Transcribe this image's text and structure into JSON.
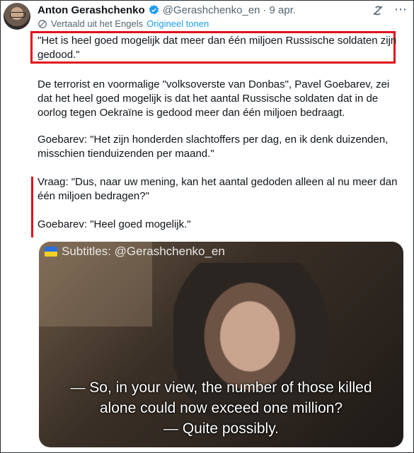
{
  "tweet": {
    "author_name": "Anton Gerashchenko",
    "handle": "@Gerashchenko_en",
    "dot": "·",
    "date": "9 apr.",
    "translated_label": "Vertaald uit het Engels",
    "original_link": "Origineel tonen",
    "quote": "\"Het is heel goed mogelijk dat meer dan één miljoen Russische soldaten zijn gedood.\"",
    "paragraphs": [
      "De terrorist en voormalige \"volksoverste van Donbas\", Pavel Goebarev, zei dat het heel goed mogelijk is dat het aantal Russische soldaten dat in de oorlog tegen Oekraïne is gedood meer dan één miljoen bedraagt.",
      "Goebarev: \"Het zijn honderden slachtoffers per dag, en ik denk duizenden, misschien tienduizenden per maand.\"",
      "Vraag: \"Dus, naar uw mening, kan het aantal gedoden alleen al nu meer dan één miljoen bedragen?\"",
      "Goebarev: \"Heel goed mogelijk.\""
    ]
  },
  "video": {
    "subtitle_credit": "Subtitles: @Gerashchenko_en",
    "caption_lines": [
      "— So, in your view, the number of those killed",
      "alone could now exceed one million?",
      "— Quite possibly."
    ]
  },
  "icons": {
    "verified": "verified-badge-icon",
    "more": "grok-icon",
    "close": "close-icon",
    "translate": "globe-icon",
    "flag": "ukraine-flag-icon"
  },
  "colors": {
    "accent": "#1d9bf0",
    "highlight": "#e0101b",
    "secondary_text": "#536471"
  }
}
